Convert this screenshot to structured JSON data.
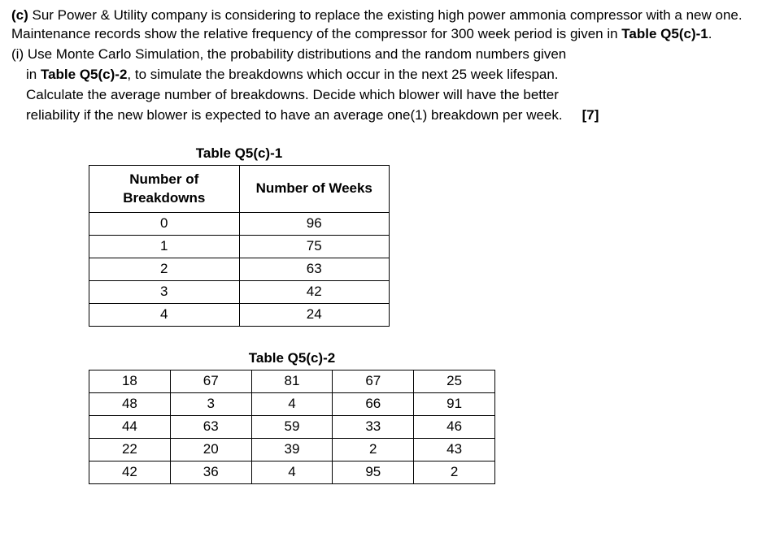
{
  "question": {
    "prefix": "(c)",
    "body1": " Sur Power & Utility company is considering to replace the existing high power ammonia compressor with a new one. Maintenance records show the relative frequency of the compressor  for 300 week period is given in ",
    "table1ref": "Table Q5(c)-1",
    "body1end": ".",
    "sub_prefix": "(i) ",
    "sub1": "Use Monte Carlo Simulation, the probability distributions and the random  numbers given",
    "sub_in": "in ",
    "table2ref": "Table Q5(c)-2",
    "sub2": ", to simulate the breakdowns which occur in the next 25 week lifespan.",
    "sub3": "Calculate the average number of breakdowns. Decide which blower will have the better",
    "sub4": "reliability if the new blower is expected to have an average one(1) breakdown per week.",
    "marks": "[7]"
  },
  "table1": {
    "title": "Table Q5(c)-1",
    "headers": {
      "col1a": "Number of",
      "col1b": "Breakdowns",
      "col2": "Number of Weeks"
    },
    "rows": [
      {
        "b": "0",
        "w": "96"
      },
      {
        "b": "1",
        "w": "75"
      },
      {
        "b": "2",
        "w": "63"
      },
      {
        "b": "3",
        "w": "42"
      },
      {
        "b": "4",
        "w": "24"
      }
    ]
  },
  "table2": {
    "title": "Table Q5(c)-2",
    "rows": [
      [
        "18",
        "67",
        "81",
        "67",
        "25"
      ],
      [
        "48",
        "3",
        "4",
        "66",
        "91"
      ],
      [
        "44",
        "63",
        "59",
        "33",
        "46"
      ],
      [
        "22",
        "20",
        "39",
        "2",
        "43"
      ],
      [
        "42",
        "36",
        "4",
        "95",
        "2"
      ]
    ]
  }
}
